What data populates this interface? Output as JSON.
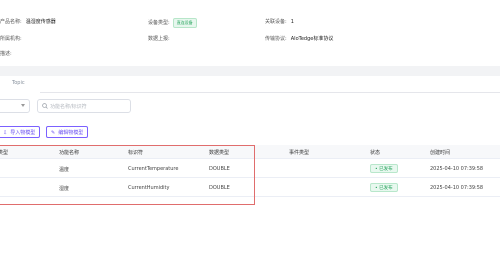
{
  "info": {
    "product_name_label": "产品名称:",
    "product_name_value": "温湿度传感器",
    "device_type_label": "设备类型:",
    "device_type_value": "直连设备",
    "related_devices_label": "关联设备:",
    "related_devices_value": "1",
    "created_label": "所属机构:",
    "created_value": "",
    "topic_label": "数据上报:",
    "topic_value": "",
    "protocol_label": "传输协议:",
    "protocol_value": "AIoTedge标准协议",
    "desc_label": "描述:"
  },
  "tabs": [
    {
      "label": ""
    },
    {
      "label": "Topic"
    }
  ],
  "filters": {
    "search_placeholder": "功能名称/标识符"
  },
  "buttons": {
    "import_label": "导入物模型",
    "edit_label": "编辑物模型"
  },
  "table": {
    "headers": {
      "type": "类型",
      "name": "功能名称",
      "identifier": "标识符",
      "data_type": "数据类型",
      "event_type": "事件类型",
      "status": "状态",
      "created_at": "创建时间"
    },
    "rows": [
      {
        "name": "温度",
        "identifier": "CurrentTemperature",
        "data_type": "DOUBLE",
        "event_type": "",
        "status": "• 已发布",
        "created_at": "2025-04-10 07:39:58"
      },
      {
        "name": "湿度",
        "identifier": "CurrentHumidity",
        "data_type": "DOUBLE",
        "event_type": "",
        "status": "• 已发布",
        "created_at": "2025-04-10 07:39:58"
      }
    ]
  }
}
